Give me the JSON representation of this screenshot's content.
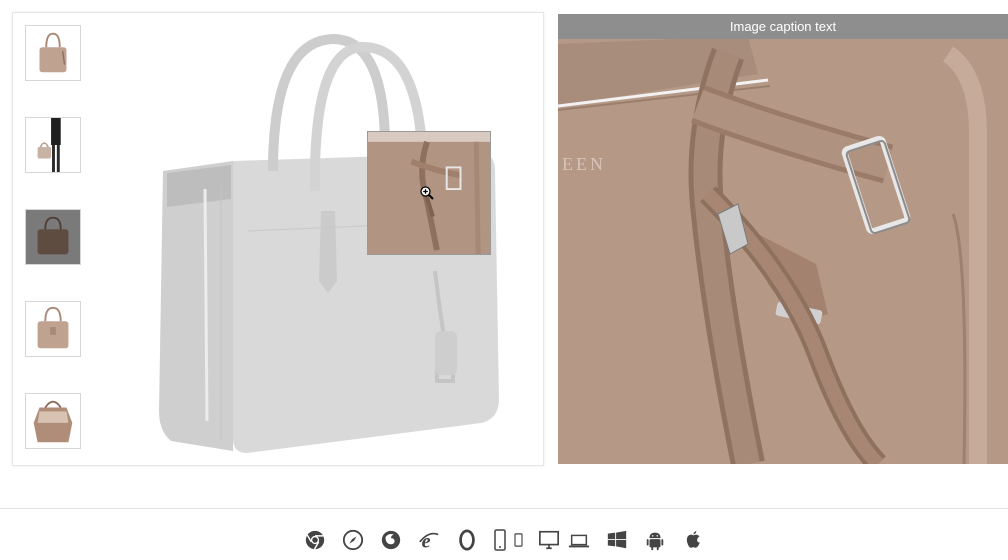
{
  "zoom_panel": {
    "caption": "Image caption text",
    "brand_fragment": "EEN"
  },
  "viewer": {
    "thumbnails": [
      {
        "name": "thumbnail-bag-front",
        "color": "#b8998a"
      },
      {
        "name": "thumbnail-bag-model",
        "color": "#c4b3a5"
      },
      {
        "name": "thumbnail-bag-dark",
        "color": "#6e5a4d"
      },
      {
        "name": "thumbnail-bag-front-2",
        "color": "#b8998a"
      },
      {
        "name": "thumbnail-bag-open",
        "color": "#a88470"
      }
    ],
    "active_thumbnail": 2
  },
  "colors": {
    "bag_grey": "#d4d4d4",
    "bag_tan": "#b29482",
    "caption_bar": "#8e8e8e"
  },
  "platform_icons": [
    "chrome-icon",
    "safari-icon",
    "firefox-icon",
    "ie-icon",
    "opera-icon",
    "phone-icon",
    "tablet-icon",
    "desktop-icon",
    "laptop-icon",
    "windows-icon",
    "android-icon",
    "apple-icon"
  ]
}
